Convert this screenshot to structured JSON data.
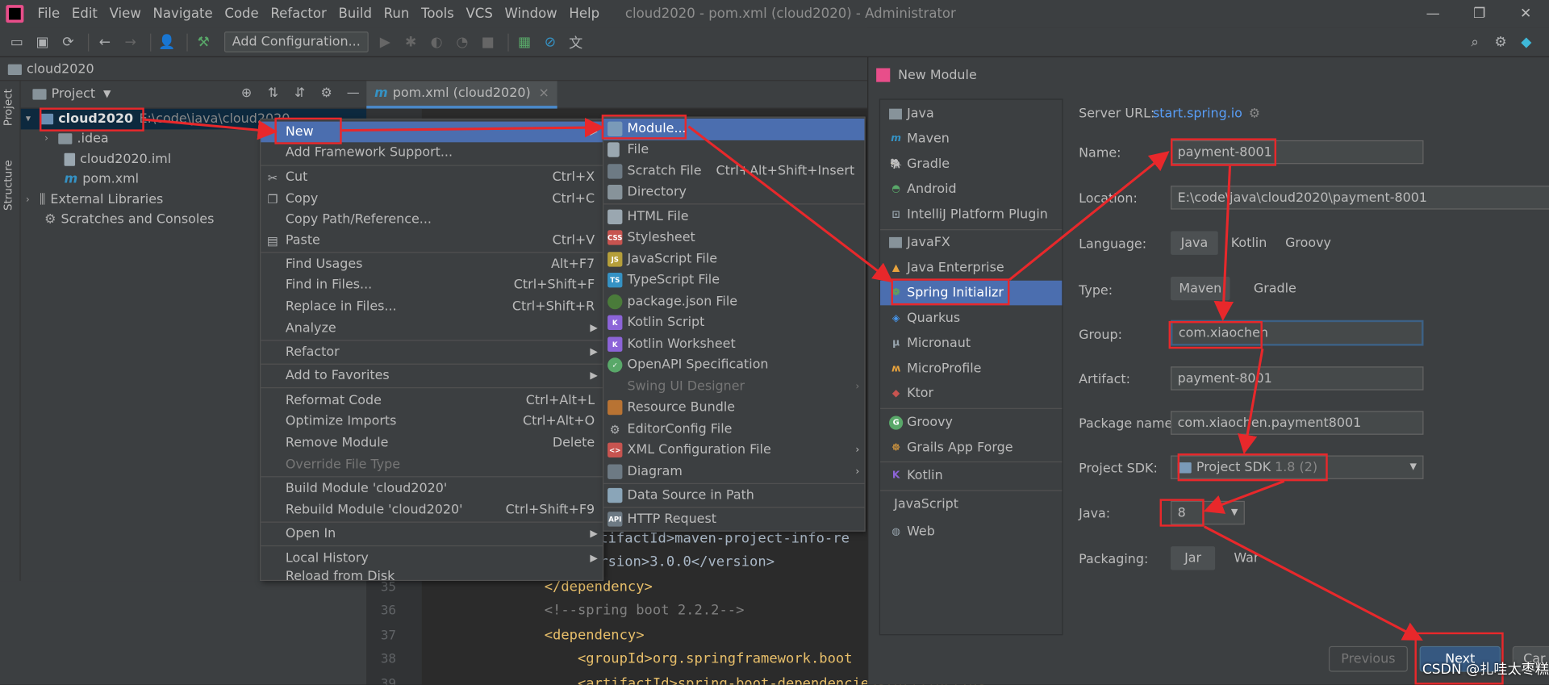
{
  "window": {
    "title": "cloud2020 - pom.xml (cloud2020) - Administrator",
    "menu": [
      "File",
      "Edit",
      "View",
      "Navigate",
      "Code",
      "Refactor",
      "Build",
      "Run",
      "Tools",
      "VCS",
      "Window",
      "Help"
    ],
    "controls": [
      "—",
      "❐",
      "✕"
    ]
  },
  "toolbar": {
    "add_config_label": "Add Configuration..."
  },
  "breadcrumb": {
    "project": "cloud2020"
  },
  "side_tabs": {
    "project": "Project",
    "structure": "Structure"
  },
  "project_panel": {
    "title": "Project",
    "tree": [
      {
        "label": "cloud2020",
        "path": "E:\\code\\java\\cloud2020"
      },
      {
        "label": ".idea"
      },
      {
        "label": "cloud2020.iml"
      },
      {
        "label": "pom.xml"
      },
      {
        "label": "External Libraries"
      },
      {
        "label": "Scratches and Consoles"
      }
    ]
  },
  "editor": {
    "tab_label": "pom.xml (cloud2020)",
    "lines": [
      {
        "num": "",
        "text": "tifactId>maven-project-info-re"
      },
      {
        "num": "",
        "text": "rsion>3.0.0</version>"
      },
      {
        "num": "35",
        "text": "</dependency>"
      },
      {
        "num": "36",
        "text": "<!--spring boot 2.2.2-->"
      },
      {
        "num": "37",
        "text": "<dependency>"
      },
      {
        "num": "38",
        "text": "    <groupId>org.springframework.boot"
      },
      {
        "num": "39",
        "text": "    <artifactId>spring-boot-dependencies</artifactId>"
      }
    ]
  },
  "context_menu": {
    "items": [
      {
        "label": "New",
        "shortcut": ""
      },
      {
        "label": "Add Framework Support...",
        "shortcut": ""
      },
      {
        "label": "Cut",
        "shortcut": "Ctrl+X"
      },
      {
        "label": "Copy",
        "shortcut": "Ctrl+C"
      },
      {
        "label": "Copy Path/Reference...",
        "shortcut": ""
      },
      {
        "label": "Paste",
        "shortcut": "Ctrl+V"
      },
      {
        "label": "Find Usages",
        "shortcut": "Alt+F7"
      },
      {
        "label": "Find in Files...",
        "shortcut": "Ctrl+Shift+F"
      },
      {
        "label": "Replace in Files...",
        "shortcut": "Ctrl+Shift+R"
      },
      {
        "label": "Analyze",
        "shortcut": ""
      },
      {
        "label": "Refactor",
        "shortcut": ""
      },
      {
        "label": "Add to Favorites",
        "shortcut": ""
      },
      {
        "label": "Reformat Code",
        "shortcut": "Ctrl+Alt+L"
      },
      {
        "label": "Optimize Imports",
        "shortcut": "Ctrl+Alt+O"
      },
      {
        "label": "Remove Module",
        "shortcut": "Delete"
      },
      {
        "label": "Override File Type",
        "shortcut": ""
      },
      {
        "label": "Build Module 'cloud2020'",
        "shortcut": ""
      },
      {
        "label": "Rebuild Module 'cloud2020'",
        "shortcut": "Ctrl+Shift+F9"
      },
      {
        "label": "Open In",
        "shortcut": ""
      },
      {
        "label": "Local History",
        "shortcut": ""
      },
      {
        "label": "Reload from Disk",
        "shortcut": ""
      }
    ]
  },
  "new_submenu": {
    "items": [
      {
        "label": "Module...",
        "shortcut": ""
      },
      {
        "label": "File",
        "shortcut": ""
      },
      {
        "label": "Scratch File",
        "shortcut": "Ctrl+Alt+Shift+Insert"
      },
      {
        "label": "Directory",
        "shortcut": ""
      },
      {
        "label": "HTML File",
        "shortcut": ""
      },
      {
        "label": "Stylesheet",
        "shortcut": ""
      },
      {
        "label": "JavaScript File",
        "shortcut": ""
      },
      {
        "label": "TypeScript File",
        "shortcut": ""
      },
      {
        "label": "package.json File",
        "shortcut": ""
      },
      {
        "label": "Kotlin Script",
        "shortcut": ""
      },
      {
        "label": "Kotlin Worksheet",
        "shortcut": ""
      },
      {
        "label": "OpenAPI Specification",
        "shortcut": ""
      },
      {
        "label": "Swing UI Designer",
        "shortcut": ""
      },
      {
        "label": "Resource Bundle",
        "shortcut": ""
      },
      {
        "label": "EditorConfig File",
        "shortcut": ""
      },
      {
        "label": "XML Configuration File",
        "shortcut": ""
      },
      {
        "label": "Diagram",
        "shortcut": ""
      },
      {
        "label": "Data Source in Path",
        "shortcut": ""
      },
      {
        "label": "HTTP Request",
        "shortcut": ""
      }
    ]
  },
  "dialog": {
    "title": "New Module",
    "generators": [
      "Java",
      "Maven",
      "Gradle",
      "Android",
      "IntelliJ Platform Plugin",
      "JavaFX",
      "Java Enterprise",
      "Spring Initializr",
      "Quarkus",
      "Micronaut",
      "MicroProfile",
      "Ktor",
      "Groovy",
      "Grails App Forge",
      "Kotlin",
      "JavaScript",
      "Web"
    ],
    "server_url_label": "Server URL:",
    "server_url": "start.spring.io",
    "name_label": "Name:",
    "name": "payment-8001",
    "location_label": "Location:",
    "location": "E:\\code\\java\\cloud2020\\payment-8001",
    "language_label": "Language:",
    "languages": [
      "Java",
      "Kotlin",
      "Groovy"
    ],
    "type_label": "Type:",
    "types": [
      "Maven",
      "Gradle"
    ],
    "group_label": "Group:",
    "group": "com.xiaochen",
    "artifact_label": "Artifact:",
    "artifact": "payment-8001",
    "package_label": "Package name:",
    "package": "com.xiaochen.payment8001",
    "sdk_label": "Project SDK:",
    "sdk_name": "Project SDK",
    "sdk_version": "1.8 (2)",
    "java_label": "Java:",
    "java": "8",
    "packaging_label": "Packaging:",
    "packagings": [
      "Jar",
      "War"
    ],
    "previous": "Previous",
    "next": "Next",
    "cancel": "Car"
  },
  "watermark": "CSDN @扎哇太枣糕",
  "colors": {
    "selection": "#4b6eaf",
    "annotation": "#e8282b",
    "panel": "#3c3f41",
    "editor": "#2b2b2b"
  }
}
